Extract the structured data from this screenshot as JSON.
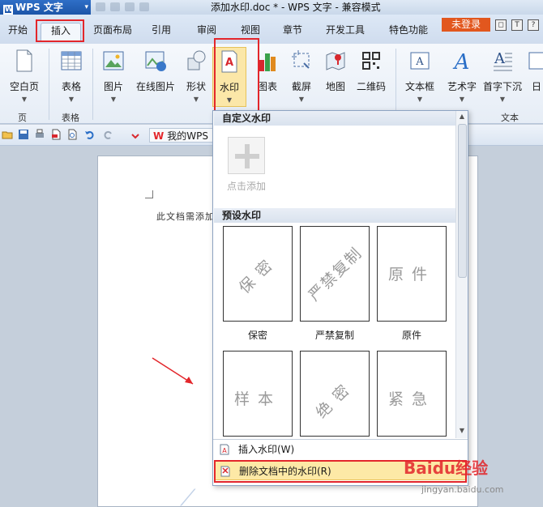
{
  "titlebar": {
    "app_name": "WPS 文字",
    "doc_title": "添加水印.doc * - WPS 文字 - 兼容模式"
  },
  "tabs": [
    {
      "label": "开始"
    },
    {
      "label": "插入"
    },
    {
      "label": "页面布局"
    },
    {
      "label": "引用"
    },
    {
      "label": "审阅"
    },
    {
      "label": "视图"
    },
    {
      "label": "章节"
    },
    {
      "label": "开发工具"
    },
    {
      "label": "特色功能"
    }
  ],
  "active_tab": "插入",
  "login_label": "未登录",
  "ribbon": {
    "buttons": [
      {
        "label": "空白页"
      },
      {
        "label": "表格"
      },
      {
        "label": "图片"
      },
      {
        "label": "在线图片"
      },
      {
        "label": "形状"
      },
      {
        "label": "水印"
      },
      {
        "label": "图表"
      },
      {
        "label": "截屏"
      },
      {
        "label": "地图"
      },
      {
        "label": "二维码"
      },
      {
        "label": "文本框"
      },
      {
        "label": "艺术字"
      },
      {
        "label": "首字下沉"
      },
      {
        "label": "日"
      }
    ],
    "groups": {
      "page": "页",
      "table": "表格",
      "text": "文本"
    }
  },
  "qat": {
    "mywps_label": "我的WPS",
    "mywps_brand": "W"
  },
  "document": {
    "body_text": "此文档需添加"
  },
  "watermark_panel": {
    "custom_header": "自定义水印",
    "add_label": "点击添加",
    "preset_header": "预设水印",
    "presets": [
      {
        "text": "保密",
        "label": "保密"
      },
      {
        "text": "严禁复制",
        "label": "严禁复制"
      },
      {
        "text": "原件",
        "label": "原件"
      },
      {
        "text": "样本",
        "label": "样本"
      },
      {
        "text": "绝密",
        "label": "绝密"
      },
      {
        "text": "紧急",
        "label": "紧急"
      }
    ],
    "menu": {
      "insert": "插入水印(W)",
      "remove": "删除文档中的水印(R)"
    }
  },
  "overlay": {
    "brand": "Baidu经验",
    "url": "jingyan.baidu.com"
  },
  "colors": {
    "accent_red": "#e3262b",
    "login_orange": "#e2571e",
    "highlight_yellow": "#fde9a6"
  }
}
